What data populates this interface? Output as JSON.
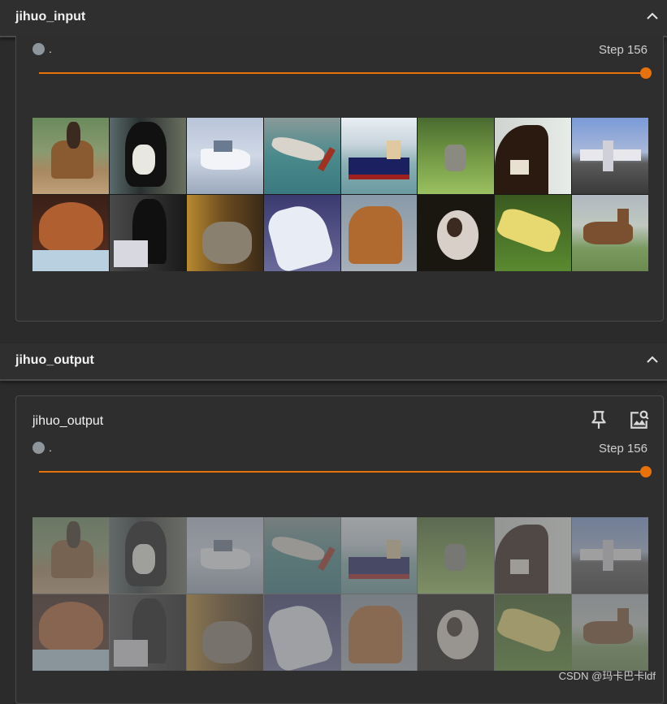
{
  "sections": [
    {
      "title": "jihuo_input",
      "card": {
        "title": "",
        "run_name": ".",
        "step_label": "Step 156"
      }
    },
    {
      "title": "jihuo_output",
      "card": {
        "title": "jihuo_output",
        "run_name": ".",
        "step_label": "Step 156"
      }
    }
  ],
  "colors": {
    "accent": "#e8710a",
    "run_dot": "#8e969c"
  },
  "icons": {
    "collapse": "chevron-up-icon",
    "pin": "pin-icon",
    "image_search": "image-search-icon"
  },
  "watermark": "CSDN @玛卡巴卡ldf"
}
